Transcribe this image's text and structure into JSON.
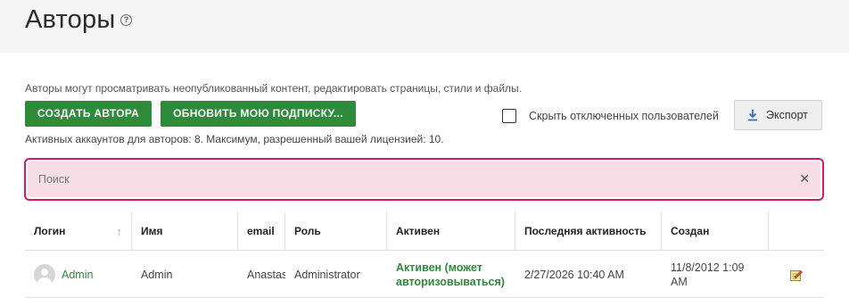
{
  "header": {
    "title": "Авторы"
  },
  "description": "Авторы могут просматривать неопубликованный контент, редактировать страницы, стили и файлы.",
  "actions": {
    "create_label": "СОЗДАТЬ АВТОРА",
    "update_label": "ОБНОВИТЬ МОЮ ПОДПИСКУ...",
    "hide_disabled_label": "Скрыть отключенных пользователей",
    "hide_disabled_checked": false,
    "export_label": "Экспорт"
  },
  "license_info": "Активных аккаунтов для авторов: 8. Максимум, разрешенный вашей лицензией: 10.",
  "search": {
    "placeholder": "Поиск",
    "value": ""
  },
  "table": {
    "columns": [
      "Логин",
      "Имя",
      "email",
      "Роль",
      "Активен",
      "Последняя активность",
      "Создан"
    ],
    "sort_indicator": "↑",
    "rows": [
      {
        "login": "Admin",
        "name": "Admin",
        "email": "Anastas",
        "role": "Administrator",
        "active": "Активен (может авторизовываться)",
        "last_activity": "2/27/2026 10:40 AM",
        "created": "11/8/2012 1:09 AM"
      }
    ]
  },
  "colors": {
    "accent": "#2e8b3a",
    "search_border": "#d11a6a",
    "search_bg": "#f6dde6"
  }
}
